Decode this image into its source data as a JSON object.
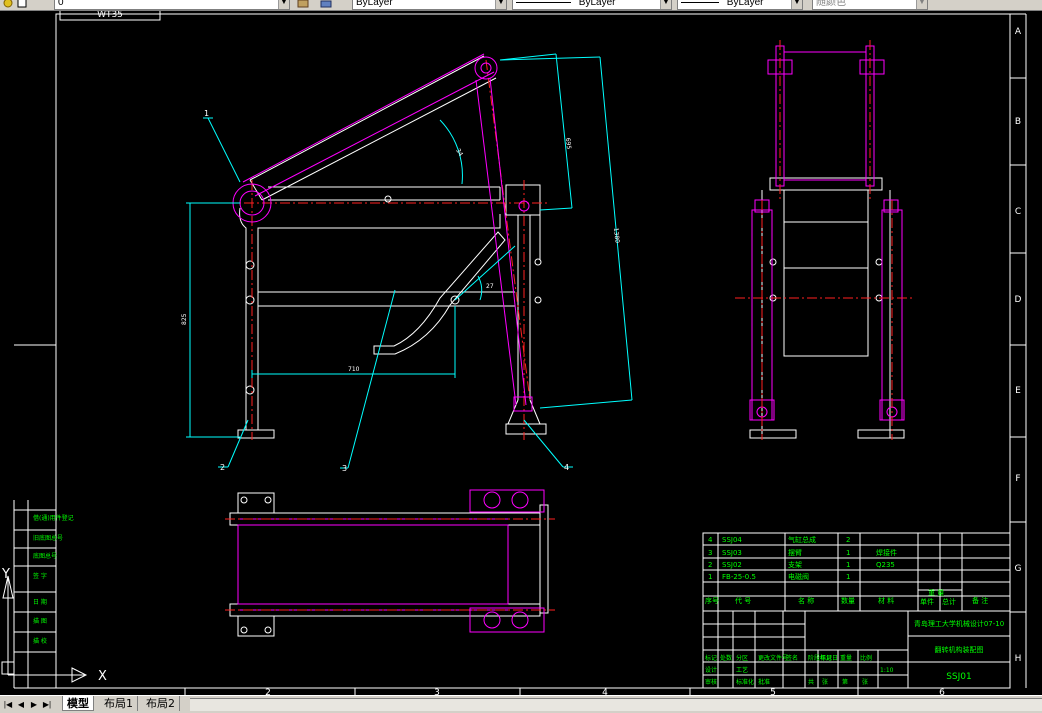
{
  "toolbar": {
    "layer_value": "0",
    "color_value": "ByLayer",
    "linetype_value": "ByLayer",
    "lineweight_value": "ByLayer",
    "plotstyle_value": "随颜色"
  },
  "drawing": {
    "top_label": "WT35",
    "zone_letters": [
      "A",
      "B",
      "C",
      "D",
      "E",
      "F",
      "G",
      "H"
    ],
    "zone_numbers": [
      "2",
      "3",
      "4",
      "5",
      "6"
    ],
    "callouts": [
      "1",
      "2",
      "3",
      "4"
    ],
    "dims": {
      "frame_height": "825",
      "frame_width": "710",
      "arm_short": "695",
      "arm_long": "1380",
      "angle_a": "34",
      "angle_b": "27"
    },
    "ucs": {
      "x": "X",
      "y": "Y"
    },
    "left_strip_labels": [
      "借(通)用件登记",
      "旧底图总号",
      "底图总号",
      "签 字",
      "日 期",
      "描 图",
      "描 校"
    ]
  },
  "bom": {
    "rows": [
      {
        "no": "4",
        "code": "SSJ04",
        "name": "气缸总成",
        "qty": "2",
        "material": ""
      },
      {
        "no": "3",
        "code": "SSJ03",
        "name": "摆臂",
        "qty": "1",
        "material": "焊接件"
      },
      {
        "no": "2",
        "code": "SSJ02",
        "name": "支架",
        "qty": "1",
        "material": "Q235"
      },
      {
        "no": "1",
        "code": "FB-25-0.5",
        "name": "电磁阀",
        "qty": "1",
        "material": ""
      }
    ],
    "header": [
      "序号",
      "代 号",
      "名 称",
      "数量",
      "材 料",
      "单件",
      "总计",
      "备 注"
    ],
    "header_weight": "重 量"
  },
  "title_block": {
    "school": "青岛理工大学机械设计07-10",
    "drawing_name": "翻转机构装配图",
    "drawing_code": "SSJ01",
    "scale": "1:10",
    "labels": [
      "标记",
      "处数",
      "分区",
      "更改文件号",
      "签名",
      "年月日",
      "设计",
      "审核",
      "工艺",
      "标准化",
      "批准",
      "阶段标记",
      "重量",
      "比例",
      "共",
      "张",
      "第",
      "张"
    ]
  },
  "tabs": {
    "model": "模型",
    "layout1": "布局1",
    "layout2": "布局2"
  }
}
